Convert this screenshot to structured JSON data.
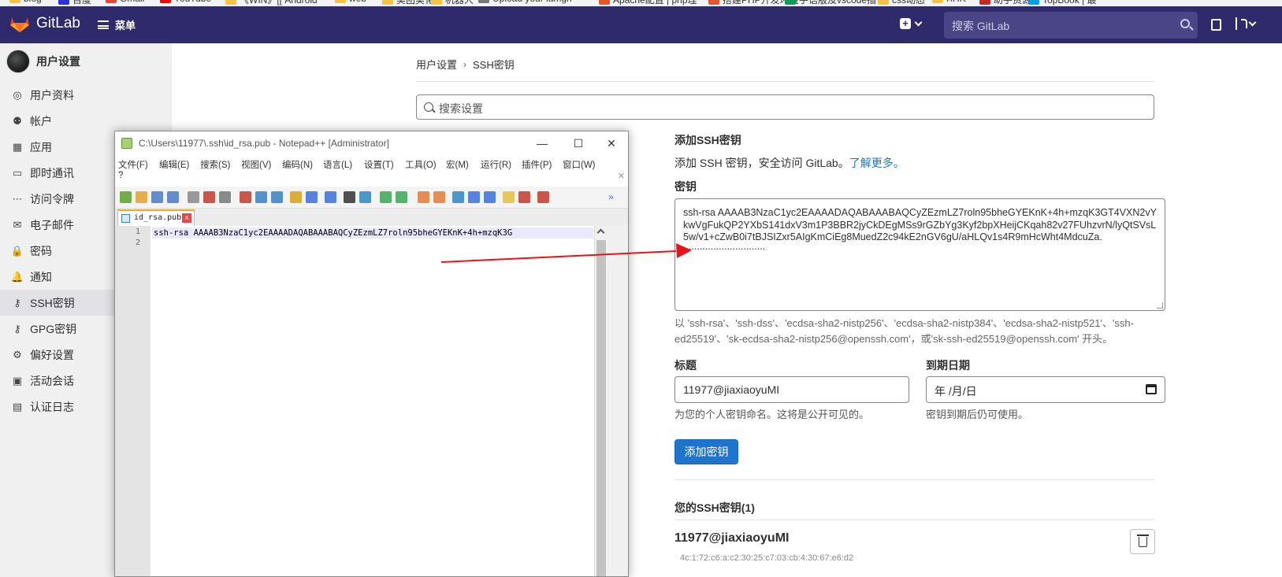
{
  "bookmarks": [
    {
      "label": "blog",
      "color": "#f6c343"
    },
    {
      "label": "百度",
      "color": "#2932e1"
    },
    {
      "label": "Gmail",
      "color": "#ea4335"
    },
    {
      "label": "YouTube",
      "color": "#ff0000"
    },
    {
      "label": "《WIN》[[ Android",
      "color": "#f6c343"
    },
    {
      "label": "web",
      "color": "#f6c343"
    },
    {
      "label": "美团美化",
      "color": "#f6c343"
    },
    {
      "label": "机器人",
      "color": "#f6c343"
    },
    {
      "label": "Upload your lamgh",
      "color": "#777777"
    },
    {
      "label": "Apache配置 | php理",
      "color": "#e8552d"
    },
    {
      "label": "搭建PHP开发环境",
      "color": "#e8552d"
    },
    {
      "label": "手语版及vscode插件",
      "color": "#0f9d58"
    },
    {
      "label": "css动态",
      "color": "#f6c343"
    },
    {
      "label": "XHK",
      "color": "#f6c343"
    },
    {
      "label": "助手资源",
      "color": "#c62828"
    },
    {
      "label": "TopBook | 最",
      "color": "#00a0e9"
    }
  ],
  "topnav": {
    "logo_text": "GitLab",
    "menu_label": "菜单",
    "search_placeholder": "搜索 GitLab",
    "plus_glyph": "+"
  },
  "sidebar": {
    "header": "用户设置",
    "items": [
      {
        "label": "用户资料",
        "icon": "user-circle-icon",
        "glyph": "◎"
      },
      {
        "label": "帐户",
        "icon": "account-icon",
        "glyph": "⚉"
      },
      {
        "label": "应用",
        "icon": "applications-icon",
        "glyph": "▦"
      },
      {
        "label": "即时通讯",
        "icon": "chat-icon",
        "glyph": "▭"
      },
      {
        "label": "访问令牌",
        "icon": "token-icon",
        "glyph": "⋯"
      },
      {
        "label": "电子邮件",
        "icon": "mail-icon",
        "glyph": "✉"
      },
      {
        "label": "密码",
        "icon": "lock-icon",
        "glyph": "🔒"
      },
      {
        "label": "通知",
        "icon": "bell-icon",
        "glyph": "🔔"
      },
      {
        "label": "SSH密钥",
        "icon": "key-icon",
        "glyph": "⚷",
        "active": true
      },
      {
        "label": "GPG密钥",
        "icon": "key-icon",
        "glyph": "⚷"
      },
      {
        "label": "偏好设置",
        "icon": "preferences-icon",
        "glyph": "⚙"
      },
      {
        "label": "活动会话",
        "icon": "monitor-icon",
        "glyph": "▣"
      },
      {
        "label": "认证日志",
        "icon": "log-icon",
        "glyph": "▤"
      }
    ]
  },
  "main": {
    "breadcrumb": [
      "用户设置",
      "SSH密钥"
    ],
    "breadcrumb_sep": "›",
    "settings_search_placeholder": "搜索设置",
    "section_title": "添加SSH密钥",
    "section_desc": "添加 SSH 密钥，安全访问 GitLab。",
    "learn_more": "了解更多。",
    "key_label": "密钥",
    "key_value": "ssh-rsa AAAAB3NzaC1yc2EAAAADAQABAAABAQCyZEzmLZ7roln95bheGYEKnK+4h+mzqK3GT4VXN2vYkwVgFukQP2YXbS141dxV3m1P3BBR2jyCkDEgMSs9rGZbYg3Kyf2bpXHeijCKqah82v27FUhzvrN/lyQtSVsL5w/v1+cZwB0i7tBJSIZxr5AIgKmCiEg8MuedZ2c94kE2nGV6gU/aHLQv1s4R9mHcWht4MdcuZa.",
    "key_value_tail": "..............................",
    "key_help": "以 'ssh-rsa'、'ssh-dss'、'ecdsa-sha2-nistp256'、'ecdsa-sha2-nistp384'、'ecdsa-sha2-nistp521'、'ssh-ed25519'、'sk-ecdsa-sha2-nistp256@openssh.com'，或'sk-ssh-ed25519@openssh.com' 开头。",
    "title_label": "标题",
    "title_value": "11977@jiaxiaoyuMI",
    "title_help": "为您的个人密钥命名。这将是公开可见的。",
    "expiry_label": "到期日期",
    "expiry_value": "年 /月/日",
    "expiry_help": "密钥到期后仍可使用。",
    "add_button": "添加密钥",
    "your_keys": "您的SSH密钥(1)",
    "key_entry_title": "11977@jiaxiaoyuMI",
    "key_entry_meta": "4c:1:72:c6:a:c2:30:25:c7:03:cb:4:30:67:e6:d2"
  },
  "notepad": {
    "title": "C:\\Users\\11977\\.ssh\\id_rsa.pub - Notepad++ [Administrator]",
    "menu": [
      "文件(F)",
      "编辑(E)",
      "搜索(S)",
      "视图(V)",
      "编码(N)",
      "语言(L)",
      "设置(T)",
      "工具(O)",
      "宏(M)",
      "运行(R)",
      "插件(P)",
      "窗口(W)"
    ],
    "menu_extra": "?",
    "tab_name": "id_rsa.pub",
    "line_numbers": [
      "1",
      "2"
    ],
    "line1": "ssh-rsa AAAAB3NzaC1yc2EAAAADAQABAAABAQCyZEzmLZ7roln95bheGYEKnK+4h+mzqK3G",
    "minimize": "—",
    "maximize": "☐",
    "close": "✕",
    "tab_close": "x"
  },
  "annotation": {
    "arrow_color": "#e8141b"
  }
}
